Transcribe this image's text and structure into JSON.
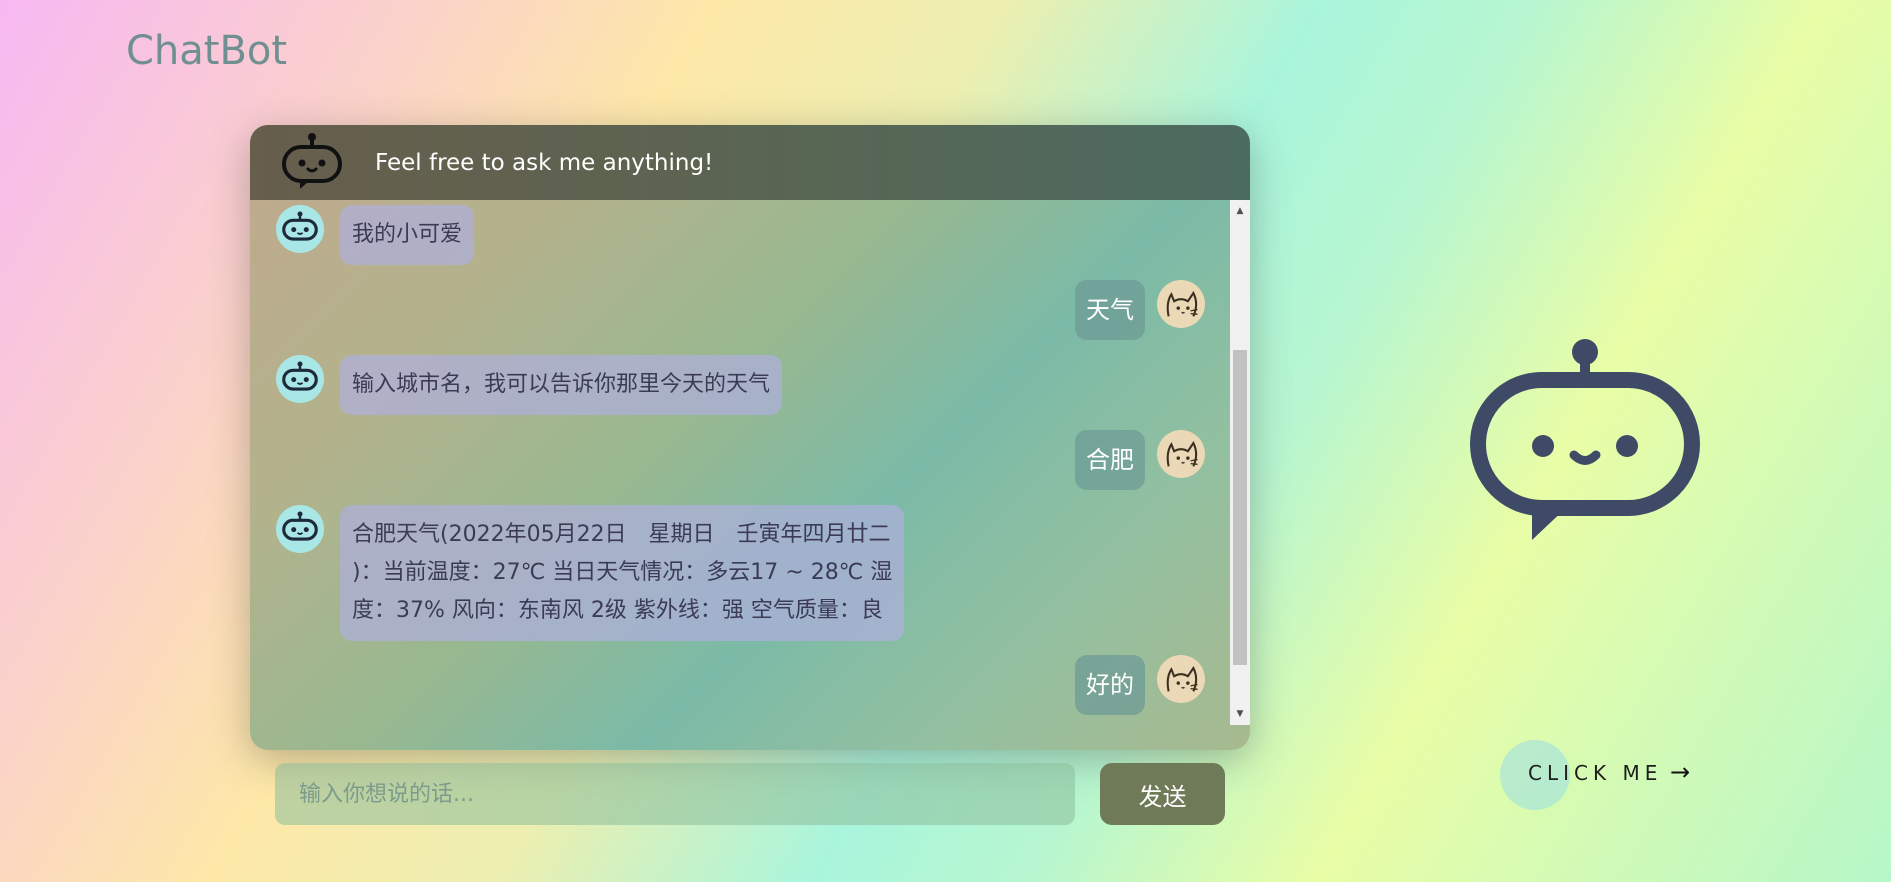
{
  "app": {
    "brand": "ChatBot"
  },
  "chat": {
    "header_title": "Feel free to ask me anything!",
    "messages": [
      {
        "from": "bot",
        "text": "我的小可爱"
      },
      {
        "from": "user",
        "text": "天气"
      },
      {
        "from": "bot",
        "text": "输入城市名，我可以告诉你那里今天的天气"
      },
      {
        "from": "user",
        "text": "合肥"
      },
      {
        "from": "bot",
        "lines": [
          "合肥天气(2022年05月22日　星期日　壬寅年四月廿二",
          ")：当前温度：27℃ 当日天气情况：多云17 ~ 28℃ 湿",
          "度：37% 风向：东南风 2级 紫外线：强 空气质量：良"
        ]
      },
      {
        "from": "user",
        "text": "好的"
      }
    ],
    "scroll_up_icon": "▲",
    "scroll_down_icon": "▼"
  },
  "composer": {
    "placeholder": "输入你想说的话...",
    "value": "",
    "send_label": "发送"
  },
  "cta": {
    "label": "CLICK ME",
    "arrow": "→"
  },
  "icons": {
    "header": "robot-icon",
    "bot_avatar": "robot-icon",
    "user_avatar": "cat-icon",
    "hero": "robot-chat-bubble-icon"
  },
  "colors": {
    "header_bg": "#5a6552",
    "bot_bubble": "#afafdc",
    "user_bubble": "#6e9b96",
    "send_button": "#6e7a58",
    "hero_robot": "#3f4a66"
  }
}
